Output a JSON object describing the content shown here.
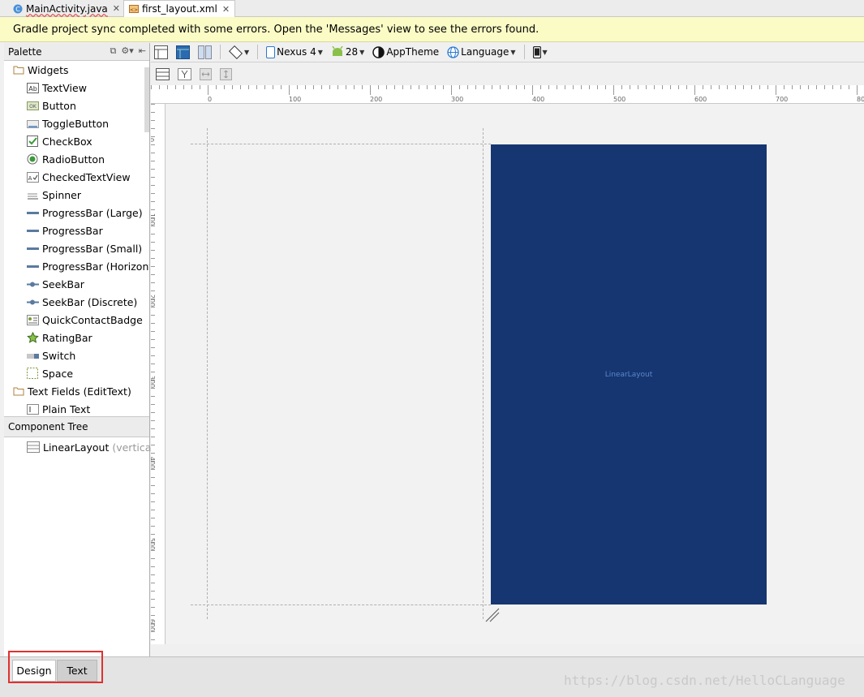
{
  "tabs": [
    {
      "label": "MainActivity.java",
      "icon": "java-class-icon"
    },
    {
      "label": "first_layout.xml",
      "icon": "xml-file-icon",
      "active": true
    }
  ],
  "banner": {
    "text": "Gradle project sync completed with some errors. Open the 'Messages' view to see the errors found."
  },
  "palette": {
    "title": "Palette",
    "categories": [
      {
        "label": "Widgets",
        "items": [
          "TextView",
          "Button",
          "ToggleButton",
          "CheckBox",
          "RadioButton",
          "CheckedTextView",
          "Spinner",
          "ProgressBar (Large)",
          "ProgressBar",
          "ProgressBar (Small)",
          "ProgressBar (Horizont",
          "SeekBar",
          "SeekBar (Discrete)",
          "QuickContactBadge",
          "RatingBar",
          "Switch",
          "Space"
        ]
      },
      {
        "label": "Text Fields (EditText)",
        "items": [
          "Plain Text"
        ]
      }
    ]
  },
  "component_tree": {
    "title": "Component Tree",
    "root": {
      "label": "LinearLayout",
      "sub": "(vertical)"
    }
  },
  "toolbar": {
    "device": "Nexus 4",
    "api": "28",
    "theme": "AppTheme",
    "language": "Language"
  },
  "ruler": {
    "top": [
      "0",
      "100",
      "200",
      "300",
      "400",
      "500",
      "600",
      "700",
      "80"
    ],
    "left": [
      "0",
      "100",
      "200",
      "300",
      "400",
      "500",
      "600"
    ]
  },
  "canvas": {
    "layout_label": "LinearLayout",
    "device_color": "#163671"
  },
  "bottom_tabs": {
    "design": "Design",
    "text": "Text"
  },
  "watermark": "https://blog.csdn.net/HelloCLanguage"
}
